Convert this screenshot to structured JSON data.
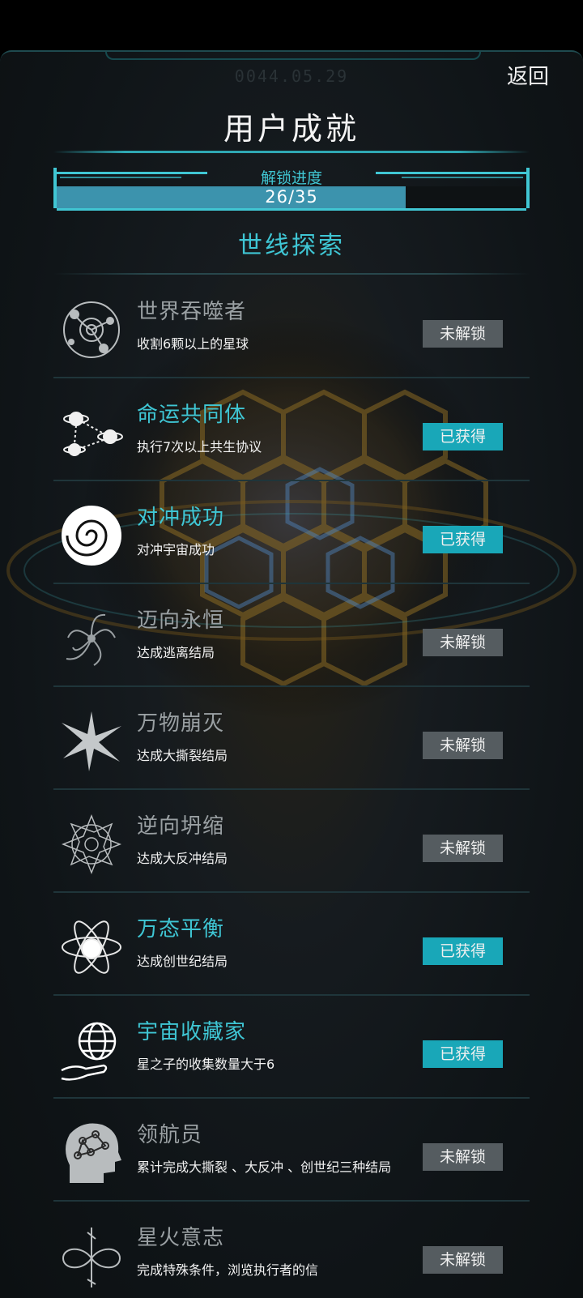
{
  "header": {
    "date": "0044.05.29",
    "back_label": "返回",
    "title": "用户成就"
  },
  "progress": {
    "label": "解锁进度",
    "text": "26/35",
    "unlocked": 26,
    "total": 35
  },
  "section_title": "世线探索",
  "colors": {
    "accent": "#3fc6d4",
    "obtained_badge": "#19a7b8",
    "locked_badge": "#555c60",
    "progress_fill": "#3c93ad"
  },
  "achievements": [
    {
      "name": "世界吞噬者",
      "desc": "收割6颗以上的星球",
      "status": "未解锁",
      "icon": "planet-orbit-icon"
    },
    {
      "name": "命运共同体",
      "desc": "执行7次以上共生协议",
      "status": "已获得",
      "icon": "linked-planets-icon"
    },
    {
      "name": "对冲成功",
      "desc": "对冲宇宙成功",
      "status": "已获得",
      "icon": "swirl-icon"
    },
    {
      "name": "迈向永恒",
      "desc": "达成逃离结局",
      "status": "未解锁",
      "icon": "vortex-icon"
    },
    {
      "name": "万物崩灭",
      "desc": "达成大撕裂结局",
      "status": "未解锁",
      "icon": "burst-icon"
    },
    {
      "name": "逆向坍缩",
      "desc": "达成大反冲结局",
      "status": "未解锁",
      "icon": "mandala-icon"
    },
    {
      "name": "万态平衡",
      "desc": "达成创世纪结局",
      "status": "已获得",
      "icon": "atom-icon"
    },
    {
      "name": "宇宙收藏家",
      "desc": "星之子的收集数量大于6",
      "status": "已获得",
      "icon": "hand-globe-icon"
    },
    {
      "name": "领航员",
      "desc": "累计完成大撕裂 、大反冲 、创世纪三种结局",
      "status": "未解锁",
      "icon": "brain-head-icon"
    },
    {
      "name": "星火意志",
      "desc": "完成特殊条件，浏览执行者的信",
      "status": "未解锁",
      "icon": "infinity-icon"
    }
  ]
}
